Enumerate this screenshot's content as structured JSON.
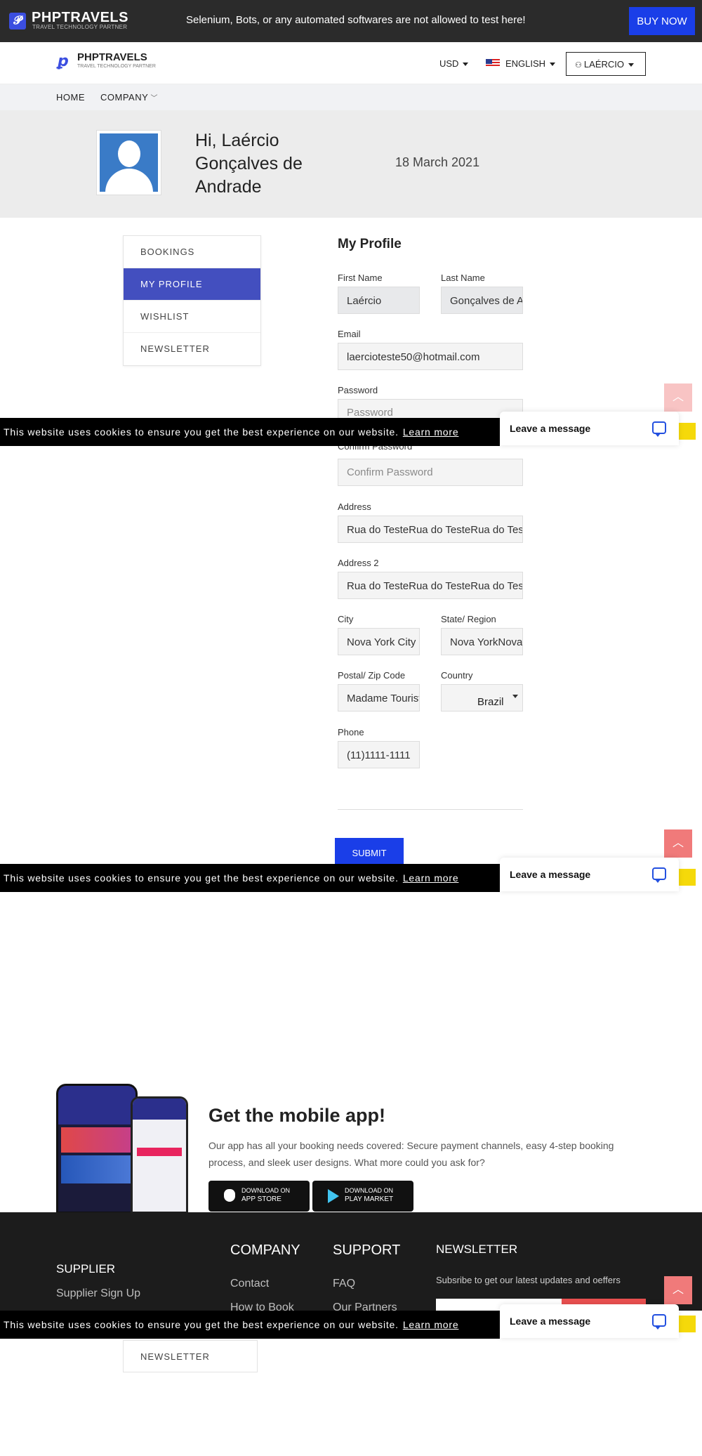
{
  "topbar": {
    "brand": "PHPTRAVELS",
    "brand_sub": "TRAVEL TECHNOLOGY PARTNER",
    "notice": "Selenium, Bots, or any automated softwares are not allowed to test here!",
    "buy_label": "BUY NOW"
  },
  "nav": {
    "brand": "PHPTRAVELS",
    "brand_sub": "TRAVEL TECHNOLOGY PARTNER",
    "currency": "USD",
    "language": "ENGLISH",
    "user": "LAÉRCIO",
    "items": [
      {
        "label": "HOME"
      },
      {
        "label": "COMPANY"
      }
    ]
  },
  "header": {
    "greeting": "Hi, Laércio Gonçalves de Andrade",
    "date": "18 March 2021"
  },
  "sidebar": {
    "items": [
      {
        "label": "BOOKINGS"
      },
      {
        "label": "MY PROFILE"
      },
      {
        "label": "WISHLIST"
      },
      {
        "label": "NEWSLETTER"
      }
    ]
  },
  "profile": {
    "title": "My Profile",
    "first_name": {
      "label": "First Name",
      "value": "Laércio"
    },
    "last_name": {
      "label": "Last Name",
      "value": "Gonçalves de Andrade"
    },
    "email": {
      "label": "Email",
      "value": "laercioteste50@hotmail.com"
    },
    "password": {
      "label": "Password",
      "placeholder": "Password"
    },
    "confirm_password": {
      "label": "Confirm Password",
      "placeholder": "Confirm Password"
    },
    "address": {
      "label": "Address",
      "value": "Rua do TesteRua do TesteRua do Teste"
    },
    "address2": {
      "label": "Address 2",
      "value": "Rua do TesteRua do TesteRua do Teste"
    },
    "city": {
      "label": "City",
      "value": "Nova York City"
    },
    "state": {
      "label": "State/ Region",
      "value": "Nova YorkNova York"
    },
    "postal": {
      "label": "Postal/ Zip Code",
      "value": "Madame Tourist"
    },
    "country": {
      "label": "Country",
      "value": "Brazil"
    },
    "phone": {
      "label": "Phone",
      "value": "(11)1111-1111"
    },
    "submit_label": "SUBMIT"
  },
  "cookie": {
    "text": "This website uses cookies to ensure you get the best experience on our website.",
    "learn_more": "Learn more"
  },
  "chat": {
    "label": "Leave a message"
  },
  "mobile_app": {
    "title": "Get the mobile app!",
    "description": "Our app has all your booking needs covered: Secure payment channels, easy 4-step booking process, and sleek user designs. What more could you ask for?",
    "app_store": {
      "small": "DOWNLOAD ON",
      "big": "APP STORE"
    },
    "play_store": {
      "small": "DOWNLOAD ON",
      "big": "PLAY MARKET"
    }
  },
  "footer": {
    "supplier": {
      "title": "SUPPLIER",
      "link": "Supplier Sign Up"
    },
    "company": {
      "title": "COMPANY",
      "links": [
        "Contact",
        "How to Book"
      ]
    },
    "support": {
      "title": "SUPPORT",
      "links": [
        "FAQ",
        "Our Partners"
      ]
    },
    "newsletter": {
      "title": "NEWSLETTER",
      "text": "Subsribe to get our latest updates and oeffers"
    }
  },
  "side_newsletter": "NEWSLETTER",
  "colors": {
    "accent": "#434fbf",
    "primary_button": "#1a3ee8",
    "topbar": "#2b2b2b",
    "footer": "#1c1c1c",
    "cookie_bar": "#000000",
    "scroll_up": "#f07a7a"
  }
}
